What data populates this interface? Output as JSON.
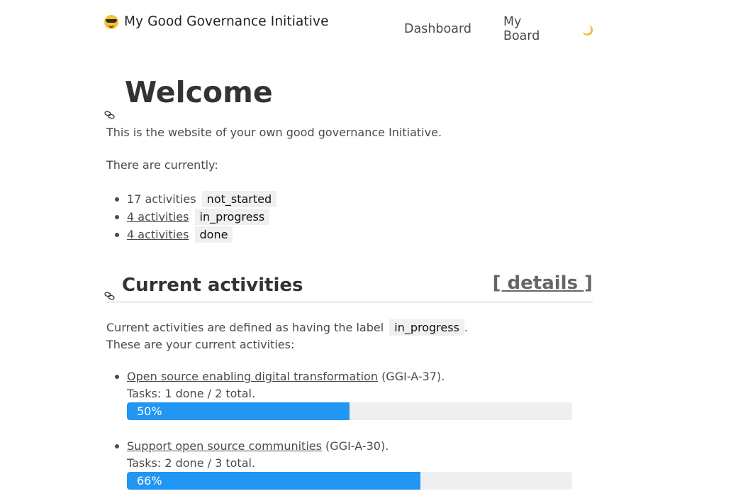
{
  "header": {
    "brand_icon": "smiling-face-with-sunglasses-emoji",
    "brand_title": "My Good Governance Initiative",
    "nav": [
      {
        "label": "Dashboard"
      },
      {
        "label": "My Board"
      }
    ],
    "theme_toggle_icon": "crescent-moon-icon"
  },
  "welcome": {
    "anchor_icon": "link-icon",
    "title": "Welcome",
    "intro": "This is the website of your own good governance Initiative.",
    "currently": "There are currently:",
    "status_counts": [
      {
        "count_text": "17 activities",
        "is_link": false,
        "label": "not_started"
      },
      {
        "count_text": "4 activities",
        "is_link": true,
        "label": "in_progress"
      },
      {
        "count_text": "4 activities",
        "is_link": true,
        "label": "done"
      }
    ]
  },
  "current_activities": {
    "anchor_icon": "link-icon",
    "title": "Current activities",
    "details_link": "[ details ]",
    "definition_prefix": "Current activities are defined as having the label",
    "definition_label": "in_progress",
    "definition_suffix": ".",
    "list_intro": "These are your current activities:",
    "items": [
      {
        "title": "Open source enabling digital transformation",
        "id_text": "(GGI-A-37).",
        "tasks_text": "Tasks: 1 done / 2 total.",
        "progress_percent": 50,
        "progress_label": "50%"
      },
      {
        "title": "Support open source communities",
        "id_text": "(GGI-A-30).",
        "tasks_text": "Tasks: 2 done / 3 total.",
        "progress_percent": 66,
        "progress_label": "66%"
      }
    ]
  },
  "colors": {
    "progress_fill": "#2196f3",
    "progress_track": "#efefef",
    "label_background": "#f0f0f0",
    "text": "#4a4a4a",
    "heading": "#333333"
  }
}
